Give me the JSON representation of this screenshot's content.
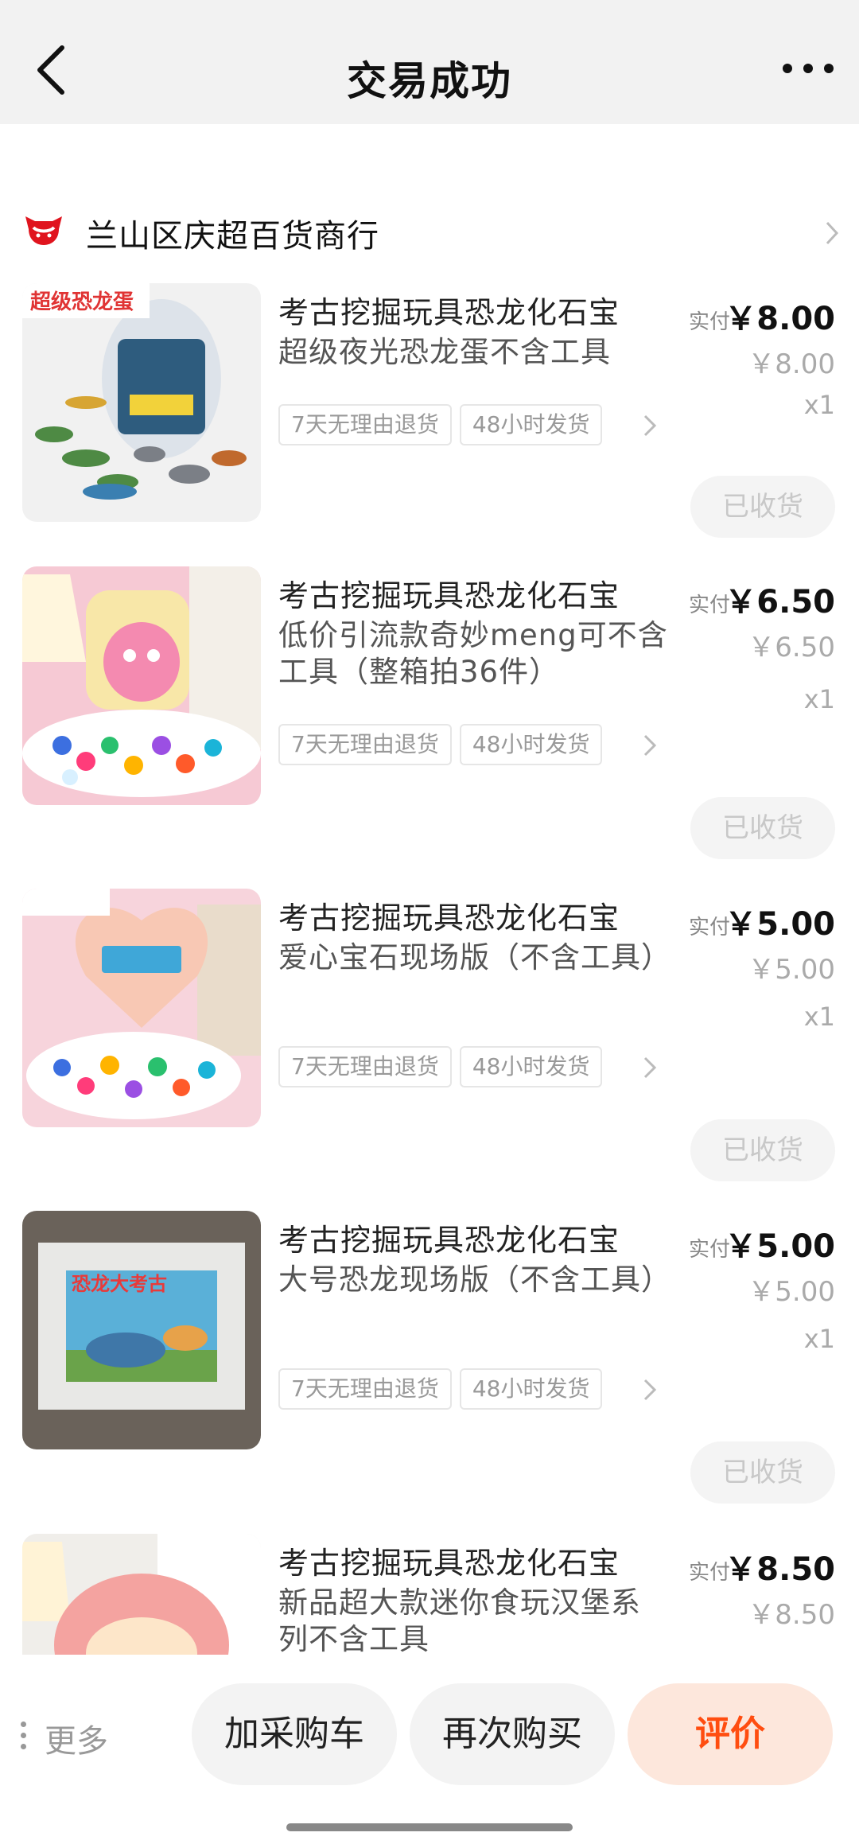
{
  "header": {
    "title": "交易成功",
    "back_icon": "chevron-left-icon",
    "more_icon": "more-horizontal-icon"
  },
  "shop": {
    "name": "兰山区庆超百货商行",
    "logo_icon": "tmall-cat-logo",
    "logo_color": "#e0141e"
  },
  "items": [
    {
      "name": "考古挖掘玩具恐龙化石宝",
      "spec": "超级夜光恐龙蛋不含工具",
      "tags": [
        "7天无理由退货",
        "48小时发货"
      ],
      "paid_label": "实付",
      "paid_amount": "￥8.00",
      "original_price": "￥8.00",
      "quantity": "x1",
      "status_button": "已收货",
      "thumb_text": "超级恐龙蛋"
    },
    {
      "name": "考古挖掘玩具恐龙化石宝",
      "spec": "低价引流款奇妙meng可不含工具（整箱拍36件）",
      "tags": [
        "7天无理由退货",
        "48小时发货"
      ],
      "paid_label": "实付",
      "paid_amount": "￥6.50",
      "original_price": "￥6.50",
      "quantity": "x1",
      "status_button": "已收货"
    },
    {
      "name": "考古挖掘玩具恐龙化石宝",
      "spec": "爱心宝石现场版（不含工具）",
      "tags": [
        "7天无理由退货",
        "48小时发货"
      ],
      "paid_label": "实付",
      "paid_amount": "￥5.00",
      "original_price": "￥5.00",
      "quantity": "x1",
      "status_button": "已收货"
    },
    {
      "name": "考古挖掘玩具恐龙化石宝",
      "spec": "大号恐龙现场版（不含工具）",
      "tags": [
        "7天无理由退货",
        "48小时发货"
      ],
      "paid_label": "实付",
      "paid_amount": "￥5.00",
      "original_price": "￥5.00",
      "quantity": "x1",
      "status_button": "已收货",
      "thumb_text": "恐龙大考古"
    },
    {
      "name": "考古挖掘玩具恐龙化石宝",
      "spec": "新品超大款迷你食玩汉堡系列不含工具",
      "paid_label": "实付",
      "paid_amount": "￥8.50",
      "original_price": "￥8.50"
    }
  ],
  "bottom_bar": {
    "more_label": "更多",
    "add_cart": "加采购车",
    "buy_again": "再次购买",
    "review": "评价",
    "review_color": "#ff4d10"
  }
}
